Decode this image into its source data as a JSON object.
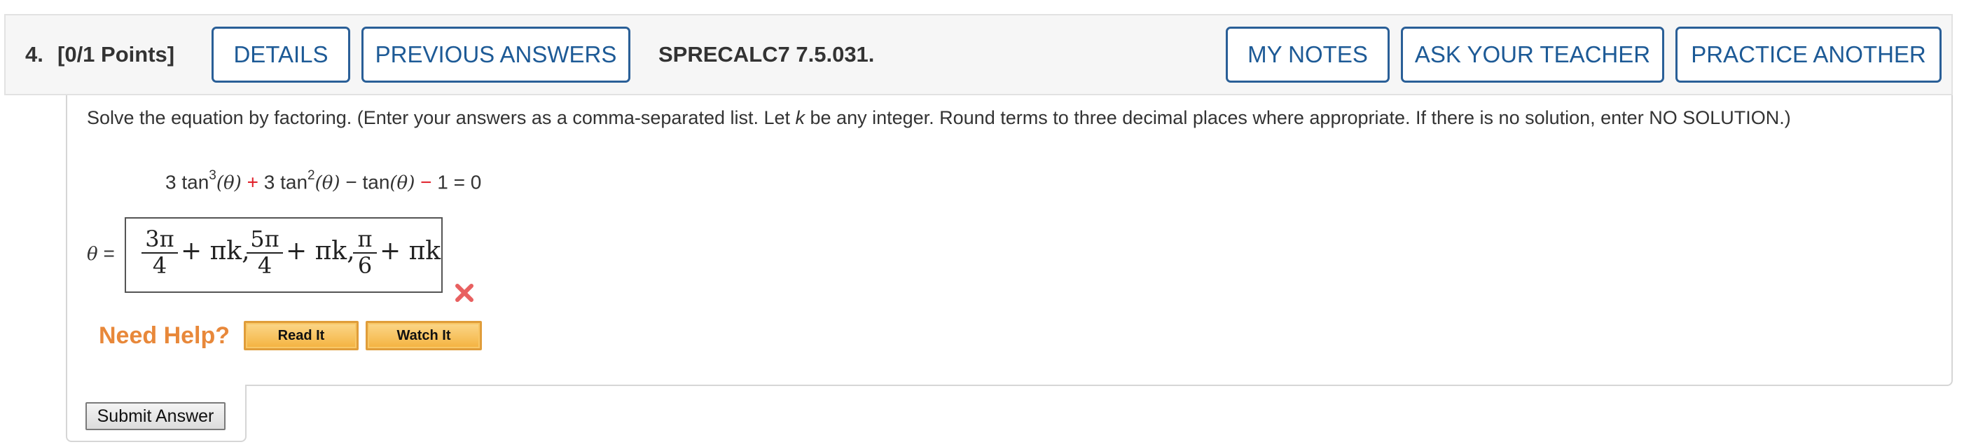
{
  "header": {
    "question_number": "4.",
    "points": "[0/1 Points]",
    "details_label": "DETAILS",
    "previous_answers_label": "PREVIOUS ANSWERS",
    "problem_id": "SPRECALC7 7.5.031.",
    "my_notes_label": "MY NOTES",
    "ask_teacher_label": "ASK YOUR TEACHER",
    "practice_another_label": "PRACTICE ANOTHER",
    "button_color": "#2a5f97"
  },
  "question": {
    "prompt_part1": "Solve the equation by factoring. (Enter your answers as a comma-separated list. Let ",
    "prompt_var": "k",
    "prompt_part2": " be any integer. Round terms to three decimal places where appropriate. If there is no solution, enter NO SOLUTION.)",
    "equation": {
      "c1": "3 tan",
      "e1": "3",
      "t1": "(θ)",
      "op1": "+",
      "c2": "3 tan",
      "e2": "2",
      "t2": "(θ)",
      "op2": "−",
      "c3": "tan",
      "t3": "(θ)",
      "op3": "−",
      "rest": "1 = 0"
    }
  },
  "answer": {
    "label_var": "θ",
    "label_eq": "=",
    "frac1_num": "3π",
    "frac1_den": "4",
    "term1": "+ πk,",
    "frac2_num": "5π",
    "frac2_den": "4",
    "term2": "+ πk,",
    "frac3_num": "π",
    "frac3_den": "6",
    "term3": "+ πk",
    "status_icon": "incorrect-x-icon",
    "status_color": "#e86060"
  },
  "help": {
    "need_help_label": "Need Help?",
    "read_it_label": "Read It",
    "watch_it_label": "Watch It",
    "accent_color": "#e8883a"
  },
  "submit": {
    "label": "Submit Answer"
  }
}
